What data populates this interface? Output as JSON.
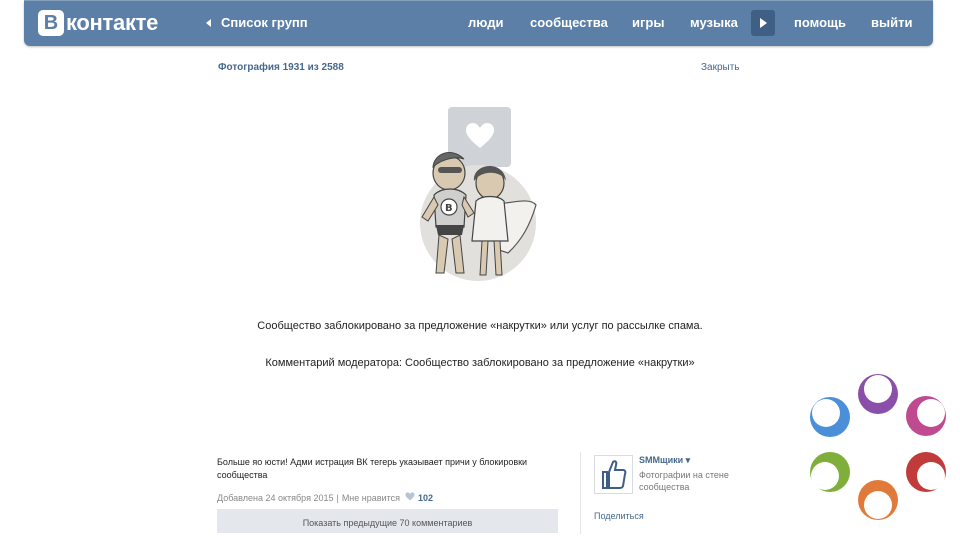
{
  "header": {
    "logo_letter": "В",
    "logo_text": "контакте",
    "back_label": "Список групп",
    "nav": [
      "люди",
      "сообщества",
      "игры",
      "музыка",
      "помощь",
      "выйти"
    ]
  },
  "viewer": {
    "counter": "Фотография 1931 из 2588",
    "close_label": "Закрыть"
  },
  "block": {
    "message": "Сообщество заблокировано за предложение «накрутки» или услуг по рассылке спама.",
    "moderator_comment": "Комментарий модератора: Сообщество заблокировано за предложение «накрутки»"
  },
  "post": {
    "text": "Больше яо юсти! Адми истрация ВК тегерь укаэывает причи у блокировки сообщества",
    "date": "Добавлена 24 октября 2015",
    "separator": "|",
    "like_label": "Мне нравится",
    "like_count": "102",
    "show_previous": "Показать предыдущие 70 комментариев"
  },
  "owner": {
    "name": "SMMщики ▾",
    "description": "Фотографии на стене сообщества",
    "share_label": "Поделиться"
  },
  "colors": {
    "header_bg": "#5b7fa6",
    "link": "#45688e",
    "deco": [
      "#4a8fd8",
      "#8a4fa8",
      "#c04a8f",
      "#7fae3a",
      "#e07a3a",
      "#c23b3b"
    ]
  }
}
